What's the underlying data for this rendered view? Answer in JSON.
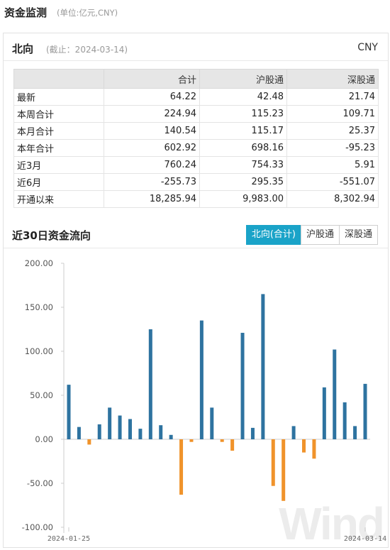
{
  "header": {
    "title": "资金监测",
    "unit": "(单位:亿元,CNY)"
  },
  "northbound": {
    "title": "北向",
    "asof": "(截止：2024-03-14)",
    "currency": "CNY",
    "table": {
      "columns": [
        "合计",
        "沪股通",
        "深股通"
      ],
      "rows": [
        {
          "label": "最新",
          "values": [
            "64.22",
            "42.48",
            "21.74"
          ]
        },
        {
          "label": "本周合计",
          "values": [
            "224.94",
            "115.23",
            "109.71"
          ]
        },
        {
          "label": "本月合计",
          "values": [
            "140.54",
            "115.17",
            "25.37"
          ]
        },
        {
          "label": "本年合计",
          "values": [
            "602.92",
            "698.16",
            "-95.23"
          ]
        },
        {
          "label": "近3月",
          "values": [
            "760.24",
            "754.33",
            "5.91"
          ]
        },
        {
          "label": "近6月",
          "values": [
            "-255.73",
            "295.35",
            "-551.07"
          ]
        },
        {
          "label": "开通以来",
          "values": [
            "18,285.94",
            "9,983.00",
            "8,302.94"
          ]
        }
      ]
    }
  },
  "flow": {
    "title": "近30日资金流向",
    "buttons": [
      {
        "label": "北向(合计)",
        "active": true
      },
      {
        "label": "沪股通",
        "active": false
      },
      {
        "label": "深股通",
        "active": false
      }
    ]
  },
  "watermark": "Wind",
  "chart_data": {
    "type": "bar",
    "title": "",
    "xlabel": "",
    "ylabel": "",
    "ylim": [
      -100,
      200
    ],
    "yticks": [
      "200.00",
      "150.00",
      "100.00",
      "50.00",
      "0.00",
      "-50.00",
      "-100.00"
    ],
    "x_tick_labels": [
      "2024-01-25",
      "2024-03-14"
    ],
    "positive_color": "#2e73a0",
    "negative_color": "#f0932b",
    "grid": false,
    "values": [
      62,
      14,
      -6,
      17,
      36,
      27,
      23,
      12,
      125,
      16,
      5,
      -63,
      -3,
      135,
      36,
      -3,
      -13,
      121,
      13,
      165,
      -53,
      -70,
      15,
      -15,
      -22,
      59,
      102,
      42,
      15,
      63
    ]
  }
}
